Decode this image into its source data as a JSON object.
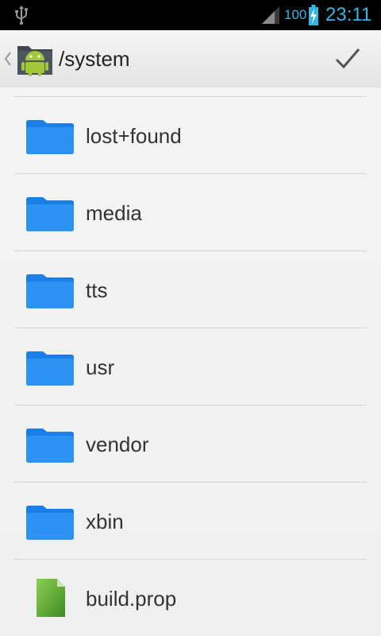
{
  "status_bar": {
    "battery_level": "100",
    "time": "23:11",
    "icons": [
      "usb-icon",
      "signal-icon",
      "battery-charging-icon"
    ],
    "accent_color": "#33b5e5"
  },
  "action_bar": {
    "path": "/system",
    "icons": [
      "up-caret-icon",
      "android-folder-icon",
      "checkmark-icon"
    ]
  },
  "list": {
    "items": [
      {
        "label": "lost+found",
        "type": "folder"
      },
      {
        "label": "media",
        "type": "folder"
      },
      {
        "label": "tts",
        "type": "folder"
      },
      {
        "label": "usr",
        "type": "folder"
      },
      {
        "label": "vendor",
        "type": "folder"
      },
      {
        "label": "xbin",
        "type": "folder"
      },
      {
        "label": "build.prop",
        "type": "file"
      }
    ],
    "folder_color": "#2a8ff0",
    "file_color": "#6db33f"
  }
}
